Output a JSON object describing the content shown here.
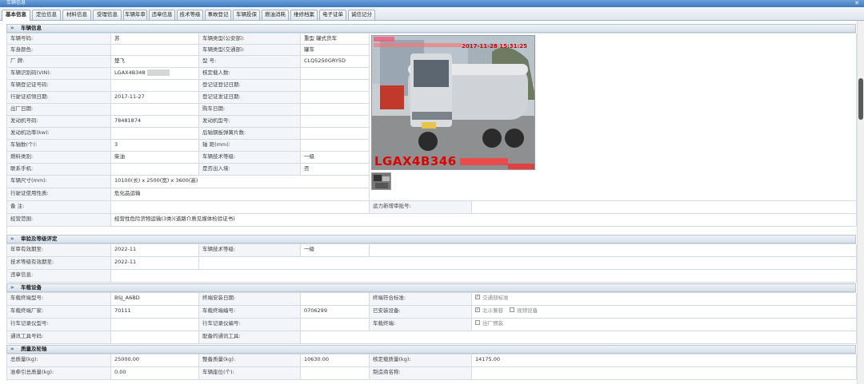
{
  "window": {
    "title": "车辆信息"
  },
  "tabs": [
    "基本信息",
    "定位信息",
    "材料信息",
    "受理信息",
    "车辆年审",
    "违章信息",
    "技术等级",
    "事故登记",
    "车辆投保",
    "燃油消耗",
    "维修档案",
    "电子证单",
    "诚信记分"
  ],
  "sections": {
    "vehicle": "车辆信息",
    "inspection": "审验及等级评定",
    "equipment": "车载设备",
    "mass": "质量及轮轴"
  },
  "vehicle": {
    "plate_label": "车辆号码:",
    "plate_value": "苏",
    "type_police_label": "车辆类型(公安部):",
    "type_police_value": "重型 罐式货车",
    "color_label": "车身颜色:",
    "color_value": "",
    "type_transport_label": "车辆类型(交通部):",
    "type_transport_value": "罐车",
    "brand_label": "厂 牌:",
    "brand_value": "楚飞",
    "model_label": "型 号:",
    "model_value": "CLQ5250GRY5D",
    "vin_label": "车辆识别码(VIN):",
    "vin_value": "LGAX4B348",
    "seats_label": "核定载人数:",
    "seats_value": "",
    "reg_cert_label": "车辆登记证号码:",
    "reg_cert_value": "",
    "reg_cert_date_label": "登记证登记日期:",
    "reg_cert_date_value": "",
    "license_date_label": "行驶证初领日期:",
    "license_date_value": "2017-11-27",
    "reg_date_label": "登记证发证日期:",
    "reg_date_value": "",
    "factory_date_label": "出厂日期:",
    "factory_date_value": "",
    "buy_date_label": "购车日期:",
    "buy_date_value": "",
    "engine_no_label": "发动机号码:",
    "engine_no_value": "78481874",
    "engine_model_label": "发动机型号:",
    "engine_model_value": "",
    "power_label": "发动机功率(kw):",
    "power_value": "",
    "spring_label": "后轴钢板弹簧片数:",
    "spring_value": "",
    "axles_label": "车轴数(个):",
    "axles_value": "3",
    "wheelbase_label": "轴 距(mm):",
    "wheelbase_value": "",
    "fuel_label": "燃料类别:",
    "fuel_value": "柴油",
    "tech_grade_label": "车辆技术等级:",
    "tech_grade_value": "一级",
    "phone_label": "联系手机:",
    "phone_value": "",
    "entered_label": "是否出入境:",
    "entered_value": "否",
    "size_label": "车辆尺寸(mm):",
    "size_value": "10100(长) x 2500(宽) x 3600(高)",
    "usage_label": "行驶证使用性质:",
    "usage_value": "危化品运输",
    "remark_label": "备 注:",
    "remark_value": "",
    "permit_label": "运力新增审批号:",
    "permit_value": "",
    "scope_label": "经营范围:",
    "scope_value": "经营性危险货物运输(3类)(道路介质见媒体检验证书)",
    "photo_stamp": "2017-11-28 15:31:25",
    "photo_plate": "LGAX4B346"
  },
  "inspection": {
    "annual_label": "年审有效期至:",
    "annual_value": "2022-11",
    "grade_label": "车辆技术等级:",
    "grade_value": "一级",
    "grade_valid_label": "技术等级有效期至:",
    "grade_valid_value": "2022-11",
    "violation_label": "违章信息:",
    "violation_value": ""
  },
  "equipment": {
    "terminal_model_label": "车载终端型号:",
    "terminal_model_value": "BSJ_A6BD",
    "install_date_label": "终端安装日期:",
    "install_date_value": "",
    "standard_label": "终端符合标准:",
    "standard_option": "交通部标准",
    "maker_label": "车载终端厂家:",
    "maker_value": "70111",
    "terminal_id_label": "车载终端编号:",
    "terminal_id_value": "0706299",
    "installed_label": "已安装设备:",
    "installed_option1": "北斗兼容",
    "installed_option2": "视频设备",
    "recorder_label": "行车记录仪型号:",
    "recorder_value": "",
    "recorder_no_label": "行车记录仪编号:",
    "recorder_no_value": "",
    "terminal_label": "车载终端:",
    "terminal_option": "出厂预装",
    "comm_no_label": "通讯工具号码:",
    "comm_no_value": "",
    "comm_tool_label": "配备的通讯工具:",
    "comm_tool_value": ""
  },
  "mass": {
    "total_label": "总质量(kg):",
    "total_value": "25000.00",
    "curb_label": "整备质量(kg):",
    "curb_value": "10630.00",
    "load_label": "核定载质量(kg):",
    "load_value": "14175.00",
    "tow_label": "准牵引总质量(kg):",
    "tow_value": "0.00",
    "seats_label": "车辆座位(个):",
    "seats_value": "",
    "maker_label": "制造商名称:",
    "maker_value": ""
  }
}
